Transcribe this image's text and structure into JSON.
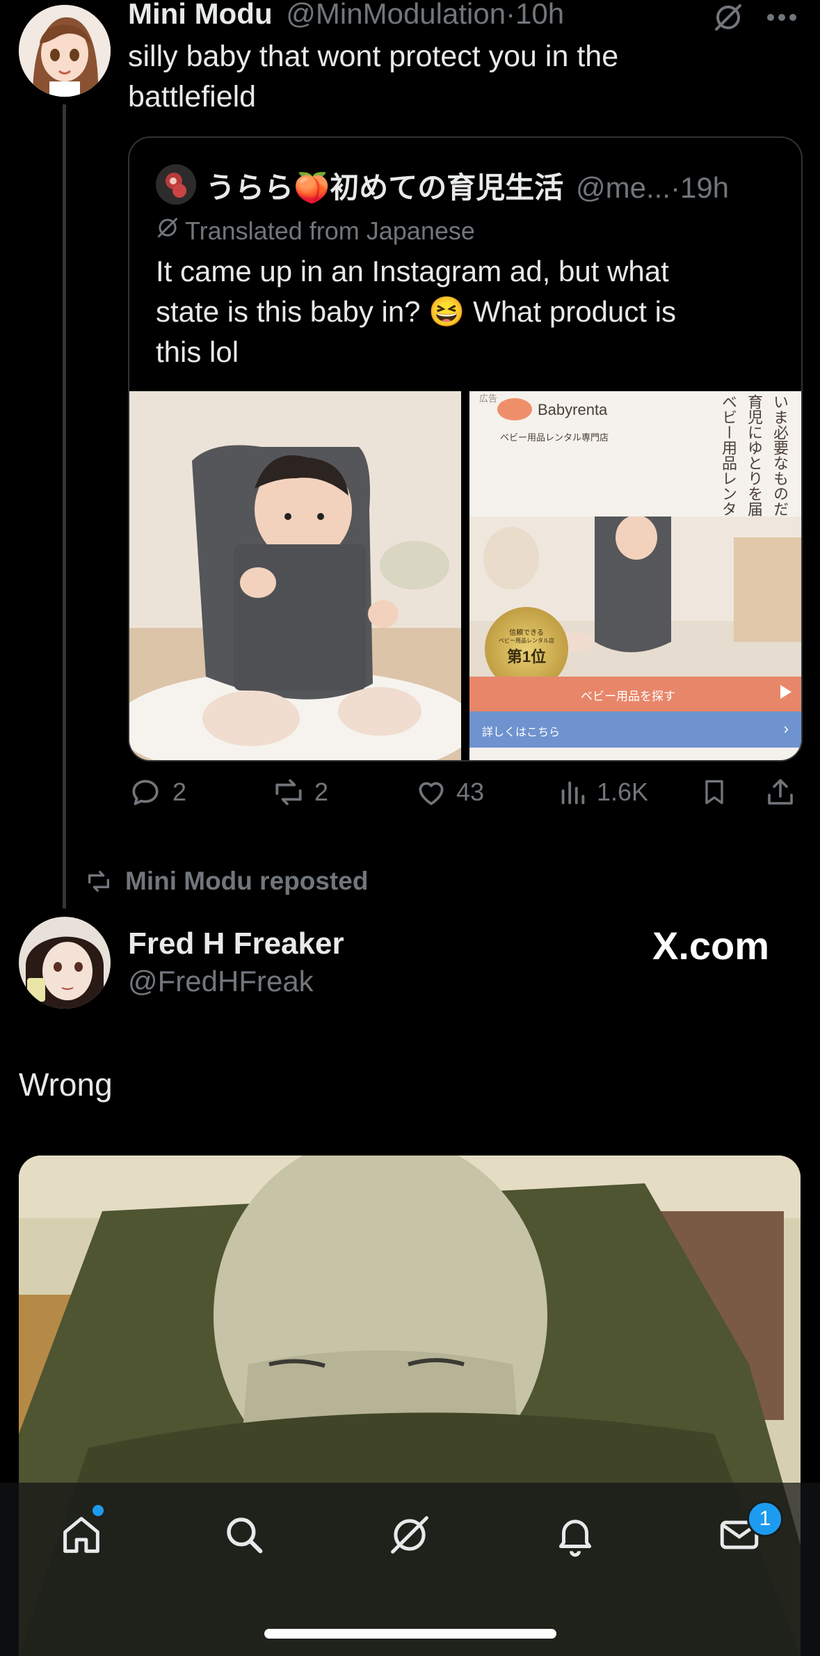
{
  "post1": {
    "author_name": "Mini Modu",
    "author_handle": "@MinModulation",
    "separator": "·",
    "time": "10h",
    "text_line1": "silly baby that wont protect you in the",
    "text_line2": "battlefield",
    "more_icon": "more-dots-icon",
    "grok_icon": "grok-icon"
  },
  "quote": {
    "author_name": "うらら🍑初めての育児生活",
    "author_handle": "@me...",
    "separator": "·",
    "time": "19h",
    "translated_label": "Translated from Japanese",
    "text_line1": "It came up in an Instagram ad, but what",
    "text_line2": "state is this baby in? 😆 What product is",
    "text_line3": "this lol",
    "ad_image": {
      "corner_tag": "広告",
      "brand": "Babyrenta",
      "subtitle": "ベビー用品レンタル専門店",
      "vertical_line1": "いま必要なものだけ。",
      "vertical_line2": "育児にゆとりを届ける",
      "vertical_line3": "ベビー用品レンタル。",
      "medal_line1": "信頼できる",
      "medal_line2": "ベビー用品レンタル店",
      "medal_line3": "第1位",
      "cta_search": "ベビー用品を探す",
      "cta_details": "詳しくはこちら"
    }
  },
  "actions": {
    "replies": "2",
    "reposts": "2",
    "likes": "43",
    "views": "1.6K"
  },
  "repost_banner": "Mini Modu reposted",
  "post2": {
    "author_name": "Fred H Freaker",
    "author_handle": "@FredHFreak",
    "watermark": "X.com",
    "text": "Wrong"
  },
  "nav": {
    "items": [
      "home-icon",
      "search-icon",
      "grok-icon",
      "notifications-icon",
      "messages-icon"
    ],
    "messages_badge": "1"
  },
  "colors": {
    "background": "#000000",
    "text": "#e7e9ea",
    "muted": "#71767b",
    "accent": "#1d9bf0",
    "border": "#2f3336"
  }
}
